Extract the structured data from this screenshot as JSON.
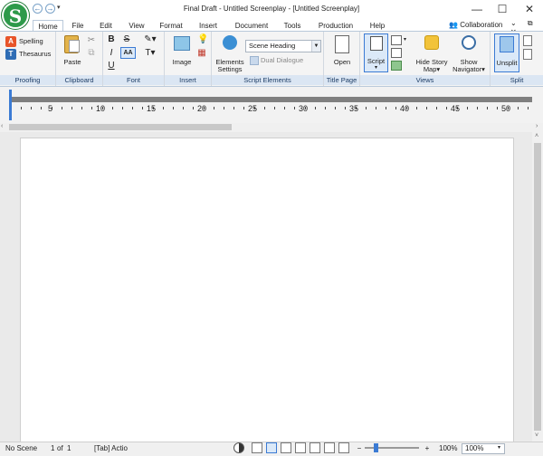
{
  "window": {
    "title": "Final Draft - Untitled Screenplay - [Untitled Screenplay]",
    "minimize": "—",
    "maximize": "☐",
    "close": "✕",
    "logo_glyph": "S"
  },
  "quick_access": {
    "back": "←",
    "forward": "→",
    "dropdown": "▾"
  },
  "tabs": [
    "Home",
    "File",
    "Edit",
    "View",
    "Format",
    "Insert",
    "Document",
    "Tools",
    "Production",
    "Help"
  ],
  "collaboration": "Collaboration",
  "mdi_controls": "⌄ ⧉ ✕",
  "groups": {
    "proofing": "Proofing",
    "clipboard": "Clipboard",
    "font": "Font",
    "insert": "Insert",
    "script_elements": "Script Elements",
    "title_page": "Title Page",
    "views": "Views",
    "split": "Split"
  },
  "proofing": {
    "spelling": "Spelling",
    "thesaurus": "Thesaurus"
  },
  "clipboard": {
    "paste": "Paste"
  },
  "font": {
    "bold": "B",
    "strike": "S",
    "italic": "I",
    "underline": "U",
    "aa": "AA",
    "text_tool": "T"
  },
  "insert": {
    "image": "Image"
  },
  "script_elements": {
    "elements_settings_1": "Elements",
    "elements_settings_2": "Settings",
    "scene_heading": "Scene Heading",
    "dual_dialogue": "Dual Dialogue"
  },
  "title_page": {
    "open": "Open"
  },
  "views": {
    "script": "Script",
    "hide_story_1": "Hide Story",
    "hide_story_2": "Map",
    "show_navigator_1": "Show",
    "show_navigator_2": "Navigator"
  },
  "split": {
    "unsplit": "Unsplit"
  },
  "ruler": {
    "labels": [
      "5",
      "10",
      "15",
      "20",
      "25",
      "30",
      "35",
      "40",
      "45",
      "50"
    ]
  },
  "status": {
    "scene": "No Scene",
    "page": "1",
    "of": "of",
    "total": "1",
    "element": "[Tab]  Actio",
    "zoom_minus": "−",
    "zoom_plus": "+",
    "zoom": "100%",
    "zoom_select": "100%"
  }
}
